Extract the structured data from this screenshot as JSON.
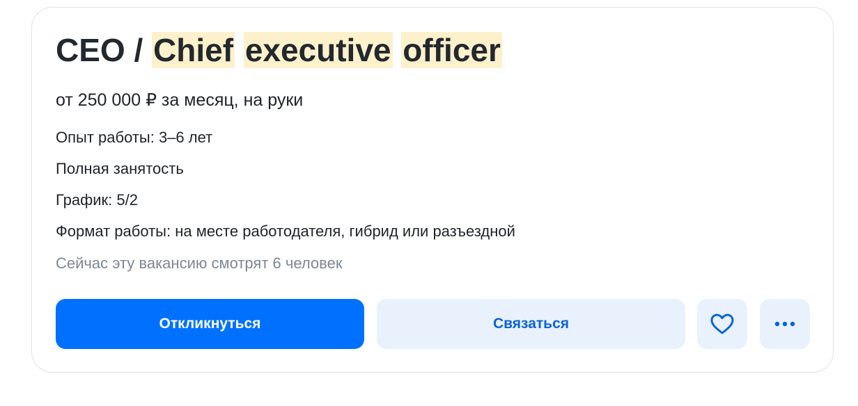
{
  "vacancy": {
    "title_prefix": "CEO /",
    "title_words": [
      "Chief",
      "executive",
      "officer"
    ],
    "salary": "от 250 000 ₽ за месяц, на руки",
    "experience": "Опыт работы: 3–6 лет",
    "employment": "Полная занятость",
    "schedule": "График: 5/2",
    "work_format": "Формат работы: на месте работодателя, гибрид или разъездной",
    "viewers": "Сейчас эту вакансию смотрят 6 человек"
  },
  "actions": {
    "respond_label": "Откликнуться",
    "contact_label": "Связаться",
    "favorite_icon": "heart-icon",
    "more_icon": "more-dots-icon"
  },
  "colors": {
    "primary": "#0070ff",
    "secondary_bg": "#e8f1fc",
    "secondary_text": "#0a63d6",
    "highlight": "#fdf1cc",
    "muted_text": "#7c8791"
  }
}
